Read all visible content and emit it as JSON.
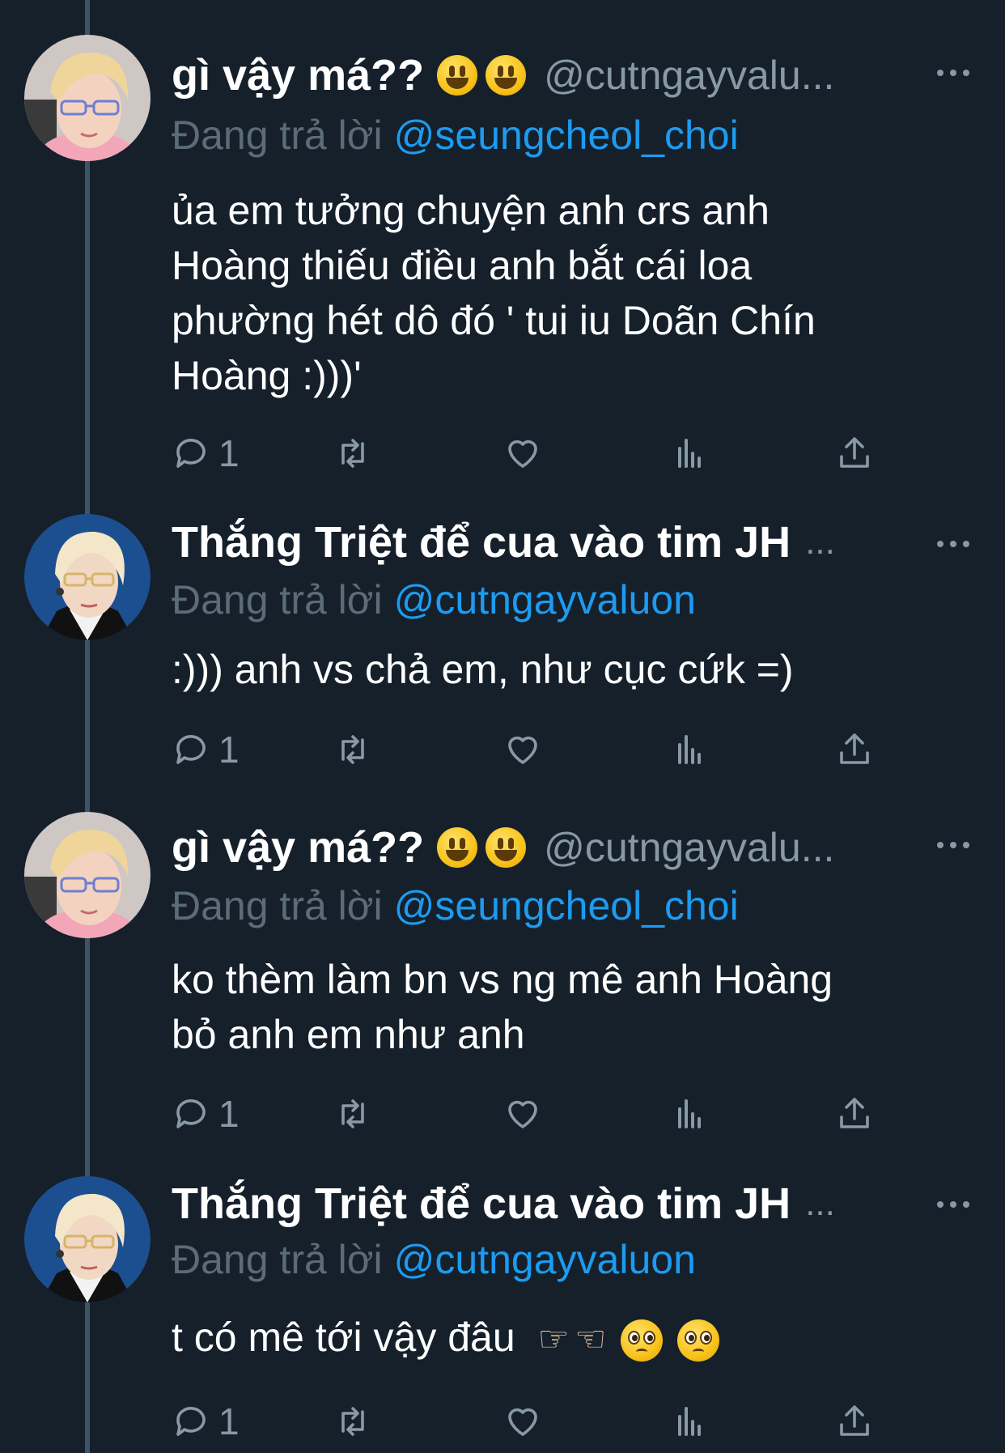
{
  "tweets": [
    {
      "display_name": "gì vậy má??",
      "display_name_emoji": [
        "grinning-face-emoji",
        "grinning-face-emoji"
      ],
      "handle": "@cutngayvalu...",
      "name_truncated": false,
      "reply_prefix": "Đang trả lời",
      "reply_mention": "@seungcheol_choi",
      "body_lines": [
        "ủa em tưởng chuyện anh crs anh",
        "Hoàng thiếu điều anh bắt cái loa",
        "phường hét dô đó ' tui iu Doãn Chín",
        "Hoàng :)))'"
      ],
      "reply_count": "1"
    },
    {
      "display_name": "Thắng Triệt để cua vào tim JH",
      "display_name_emoji": [],
      "handle": "",
      "name_truncated": true,
      "reply_prefix": "Đang trả lời",
      "reply_mention": "@cutngayvaluon",
      "body_lines": [
        ":))) anh vs chả em, như cục cứk =)"
      ],
      "reply_count": "1"
    },
    {
      "display_name": "gì vậy má??",
      "display_name_emoji": [
        "grinning-face-emoji",
        "grinning-face-emoji"
      ],
      "handle": "@cutngayvalu...",
      "name_truncated": false,
      "reply_prefix": "Đang trả lời",
      "reply_mention": "@seungcheol_choi",
      "body_lines": [
        "ko thèm làm bn vs ng mê anh Hoàng",
        "bỏ anh em như anh"
      ],
      "reply_count": "1"
    },
    {
      "display_name": "Thắng Triệt để cua vào tim JH",
      "display_name_emoji": [],
      "handle": "",
      "name_truncated": true,
      "reply_prefix": "Đang trả lời",
      "reply_mention": "@cutngayvaluon",
      "body_text": "t có mê tới vậy đâu",
      "body_emoji": [
        "pointing-hand-emoji",
        "pointing-hand-emoji",
        "pleading-face-emoji",
        "pleading-face-emoji"
      ],
      "reply_count": "1"
    }
  ],
  "ellipsis": "...",
  "icons": {
    "reply": "reply-icon",
    "retweet": "retweet-icon",
    "like": "heart-icon",
    "analytics": "analytics-icon",
    "share": "share-icon",
    "more": "more-icon"
  },
  "colors": {
    "background": "#15202b",
    "secondary_text": "#8899a6",
    "mention": "#1d9bf0",
    "thread_line": "#3d5466"
  }
}
